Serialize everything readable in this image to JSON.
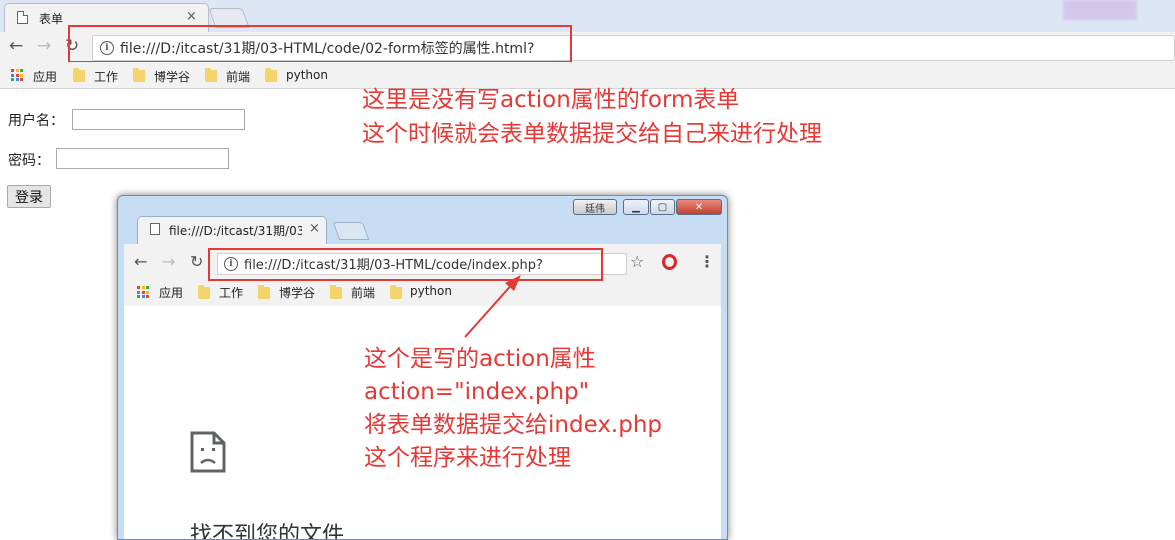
{
  "main_browser": {
    "tab_title": "表单",
    "tab_close": "×",
    "url": "file:///D:/itcast/31期/03-HTML/code/02-form标签的属性.html?",
    "bookmarks": [
      {
        "label": "应用",
        "icon": "apps-icon"
      },
      {
        "label": "工作",
        "icon": "folder-icon"
      },
      {
        "label": "博学谷",
        "icon": "folder-icon"
      },
      {
        "label": "前端",
        "icon": "folder-icon"
      },
      {
        "label": "python",
        "icon": "folder-icon"
      }
    ]
  },
  "form": {
    "username_label": "用户名：",
    "username_value": "",
    "password_label": "密码：",
    "password_value": "",
    "submit_label": "登录"
  },
  "annotation_top": {
    "line1": "这里是没有写action属性的form表单",
    "line2": "这个时候就会表单数据提交给自己来进行处理"
  },
  "inner_window": {
    "user_badge": "廷伟",
    "tab_title": "file:///D:/itcast/31期/03",
    "tab_close": "×",
    "url": "file:///D:/itcast/31期/03-HTML/code/index.php?",
    "bookmarks": [
      {
        "label": "应用",
        "icon": "apps-icon"
      },
      {
        "label": "工作",
        "icon": "folder-icon"
      },
      {
        "label": "博学谷",
        "icon": "folder-icon"
      },
      {
        "label": "前端",
        "icon": "folder-icon"
      },
      {
        "label": "python",
        "icon": "folder-icon"
      }
    ],
    "error_title": "找不到您的文件"
  },
  "annotation_bottom": {
    "line1": "这个是写的action属性",
    "line2": "action=\"index.php\"",
    "line3": "将表单数据提交给index.php",
    "line4": "这个程序来进行处理"
  },
  "colors": {
    "annotation": "#e53935",
    "highlight_box": "#e53935",
    "opera_icon": "#e0242f"
  }
}
